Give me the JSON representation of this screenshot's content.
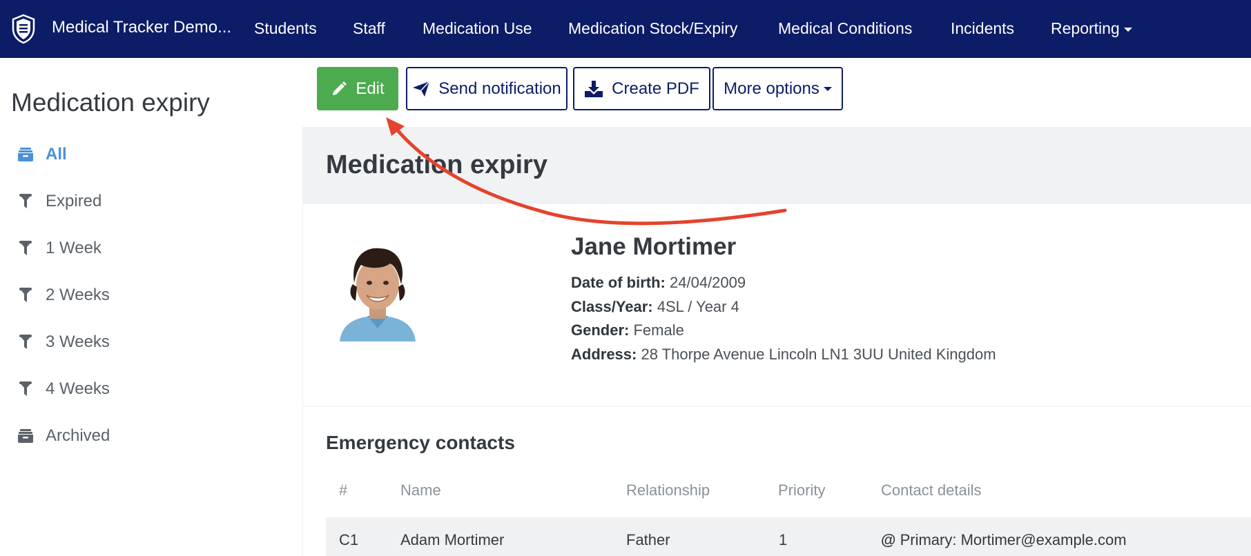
{
  "nav": {
    "brand": "Medical Tracker Demo...",
    "links": [
      "Students",
      "Staff",
      "Medication Use",
      "Medication Stock/Expiry",
      "Medical Conditions",
      "Incidents",
      "Reporting"
    ]
  },
  "sidebar": {
    "title": "Medication expiry",
    "items": [
      {
        "label": "All",
        "icon": "archive-box-icon",
        "active": true
      },
      {
        "label": "Expired",
        "icon": "filter-icon"
      },
      {
        "label": "1 Week",
        "icon": "filter-icon"
      },
      {
        "label": "2 Weeks",
        "icon": "filter-icon"
      },
      {
        "label": "3 Weeks",
        "icon": "filter-icon"
      },
      {
        "label": "4 Weeks",
        "icon": "filter-icon"
      },
      {
        "label": "Archived",
        "icon": "archive-box-icon"
      }
    ]
  },
  "toolbar": {
    "edit_label": "Edit",
    "send_label": "Send notification",
    "pdf_label": "Create PDF",
    "more_label": "More options"
  },
  "card": {
    "title": "Medication expiry"
  },
  "person": {
    "name": "Jane Mortimer",
    "dob_key": "Date of birth:",
    "dob": "24/04/2009",
    "class_key": "Class/Year:",
    "class": "4SL / Year 4",
    "gender_key": "Gender:",
    "gender": "Female",
    "address_key": "Address:",
    "address": "28 Thorpe Avenue Lincoln LN1 3UU United Kingdom"
  },
  "contacts": {
    "title": "Emergency contacts",
    "headers": [
      "#",
      "Name",
      "Relationship",
      "Priority",
      "Contact details"
    ],
    "rows": [
      {
        "id": "C1",
        "name": "Adam Mortimer",
        "relationship": "Father",
        "priority": "1",
        "contact_symbol": "@",
        "contact": "Primary: Mortimer@example.com"
      }
    ]
  },
  "colors": {
    "nav_bg": "#0c1c66",
    "edit_green": "#4caa4f",
    "active_blue": "#4a90d9",
    "annotation_arrow": "#e5432c"
  }
}
